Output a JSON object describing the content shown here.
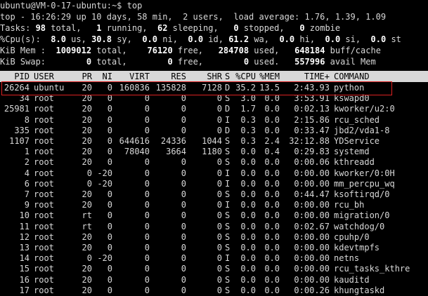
{
  "prompt": "ubuntu@VM-0-17-ubuntu:~$ top",
  "summary": {
    "top_line": "top - 16:26:29 up 10 days, 58 min,  2 users,  load average: 1.76, 1.39, 1.09",
    "tasks": [
      "Tasks: ",
      "98",
      " total,   ",
      "1",
      " running,  ",
      "62",
      " sleeping,   ",
      "0",
      " stopped,   ",
      "0",
      " zombie"
    ],
    "cpu": [
      "%Cpu(s):  ",
      "8.0",
      " us, ",
      "30.8",
      " sy,  ",
      "0.0",
      " ni,  ",
      "0.0",
      " id, ",
      "61.2",
      " wa,  ",
      "0.0",
      " hi,  ",
      "0.0",
      " si,  ",
      "0.0",
      " st"
    ],
    "mem": [
      "KiB Mem :  ",
      "1009012",
      " total,    ",
      "76120",
      " free,   ",
      "284708",
      " used,   ",
      "648184",
      " buff/cache"
    ],
    "swap": [
      "KiB Swap:        ",
      "0",
      " total,        ",
      "0",
      " free,        ",
      "0",
      " used.   ",
      "557996",
      " avail Mem"
    ]
  },
  "columns": [
    "PID",
    "USER",
    "PR",
    "NI",
    "VIRT",
    "RES",
    "SHR",
    "S",
    "%CPU",
    "%MEM",
    "TIME+",
    "COMMAND"
  ],
  "processes": [
    [
      "26264",
      "ubuntu",
      "20",
      "0",
      "160836",
      "135828",
      "7128",
      "D",
      "35.2",
      "13.5",
      "2:43.93",
      "python"
    ],
    [
      "34",
      "root",
      "20",
      "0",
      "0",
      "0",
      "0",
      "S",
      "3.0",
      "0.0",
      "3:53.91",
      "kswapd0"
    ],
    [
      "25981",
      "root",
      "20",
      "0",
      "0",
      "0",
      "0",
      "D",
      "1.7",
      "0.0",
      "0:02.13",
      "kworker/u2:0"
    ],
    [
      "8",
      "root",
      "20",
      "0",
      "0",
      "0",
      "0",
      "I",
      "0.3",
      "0.0",
      "2:15.86",
      "rcu_sched"
    ],
    [
      "335",
      "root",
      "20",
      "0",
      "0",
      "0",
      "0",
      "D",
      "0.3",
      "0.0",
      "0:33.47",
      "jbd2/vda1-8"
    ],
    [
      "1107",
      "root",
      "20",
      "0",
      "644616",
      "24336",
      "1044",
      "S",
      "0.3",
      "2.4",
      "32:12.88",
      "YDService"
    ],
    [
      "1",
      "root",
      "20",
      "0",
      "78040",
      "3664",
      "1180",
      "S",
      "0.0",
      "0.4",
      "0:29.83",
      "systemd"
    ],
    [
      "2",
      "root",
      "20",
      "0",
      "0",
      "0",
      "0",
      "S",
      "0.0",
      "0.0",
      "0:00.06",
      "kthreadd"
    ],
    [
      "4",
      "root",
      "0",
      "-20",
      "0",
      "0",
      "0",
      "I",
      "0.0",
      "0.0",
      "0:00.00",
      "kworker/0:0H"
    ],
    [
      "6",
      "root",
      "0",
      "-20",
      "0",
      "0",
      "0",
      "I",
      "0.0",
      "0.0",
      "0:00.00",
      "mm_percpu_wq"
    ],
    [
      "7",
      "root",
      "20",
      "0",
      "0",
      "0",
      "0",
      "S",
      "0.0",
      "0.0",
      "0:44.47",
      "ksoftirqd/0"
    ],
    [
      "9",
      "root",
      "20",
      "0",
      "0",
      "0",
      "0",
      "I",
      "0.0",
      "0.0",
      "0:00.00",
      "rcu_bh"
    ],
    [
      "10",
      "root",
      "rt",
      "0",
      "0",
      "0",
      "0",
      "S",
      "0.0",
      "0.0",
      "0:00.00",
      "migration/0"
    ],
    [
      "11",
      "root",
      "rt",
      "0",
      "0",
      "0",
      "0",
      "S",
      "0.0",
      "0.0",
      "0:02.67",
      "watchdog/0"
    ],
    [
      "12",
      "root",
      "20",
      "0",
      "0",
      "0",
      "0",
      "S",
      "0.0",
      "0.0",
      "0:00.00",
      "cpuhp/0"
    ],
    [
      "13",
      "root",
      "20",
      "0",
      "0",
      "0",
      "0",
      "S",
      "0.0",
      "0.0",
      "0:00.00",
      "kdevtmpfs"
    ],
    [
      "14",
      "root",
      "0",
      "-20",
      "0",
      "0",
      "0",
      "I",
      "0.0",
      "0.0",
      "0:00.00",
      "netns"
    ],
    [
      "15",
      "root",
      "20",
      "0",
      "0",
      "0",
      "0",
      "S",
      "0.0",
      "0.0",
      "0:00.00",
      "rcu_tasks_kthre"
    ],
    [
      "16",
      "root",
      "20",
      "0",
      "0",
      "0",
      "0",
      "S",
      "0.0",
      "0.0",
      "0:00.00",
      "kauditd"
    ],
    [
      "17",
      "root",
      "20",
      "0",
      "0",
      "0",
      "0",
      "S",
      "0.0",
      "0.0",
      "0:00.26",
      "khungtaskd"
    ]
  ],
  "colors": {
    "background": "#000000",
    "text": "#d8d8d8",
    "bold": "#ffffff",
    "header_bg": "#d8d8d8",
    "highlight_border": "#dd2222"
  }
}
